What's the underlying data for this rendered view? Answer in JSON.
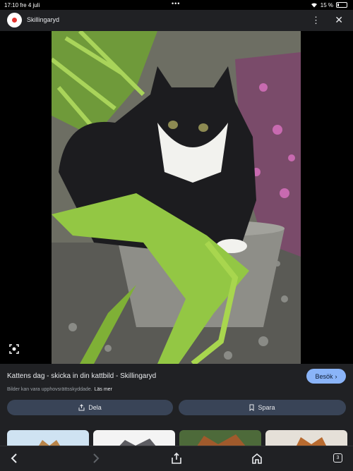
{
  "status": {
    "time": "17:10",
    "date": "fre 4 juli",
    "dots": "•••",
    "battery": "15 %"
  },
  "top": {
    "site_name": "Skillingaryd",
    "more_icon": "⋮",
    "close_icon": "✕"
  },
  "info": {
    "title": "Kattens dag - skicka in din kattbild - Skillingaryd",
    "visit_label": "Besök",
    "copyright": "Bilder kan vara upphovsrättsskyddade.",
    "learn_more": "Läs mer",
    "share_label": "Dela",
    "save_label": "Spara"
  },
  "bottom": {
    "tabs_count": "3"
  },
  "colors": {
    "accent": "#8ab4f8",
    "surface": "#202124",
    "button": "#394457"
  }
}
